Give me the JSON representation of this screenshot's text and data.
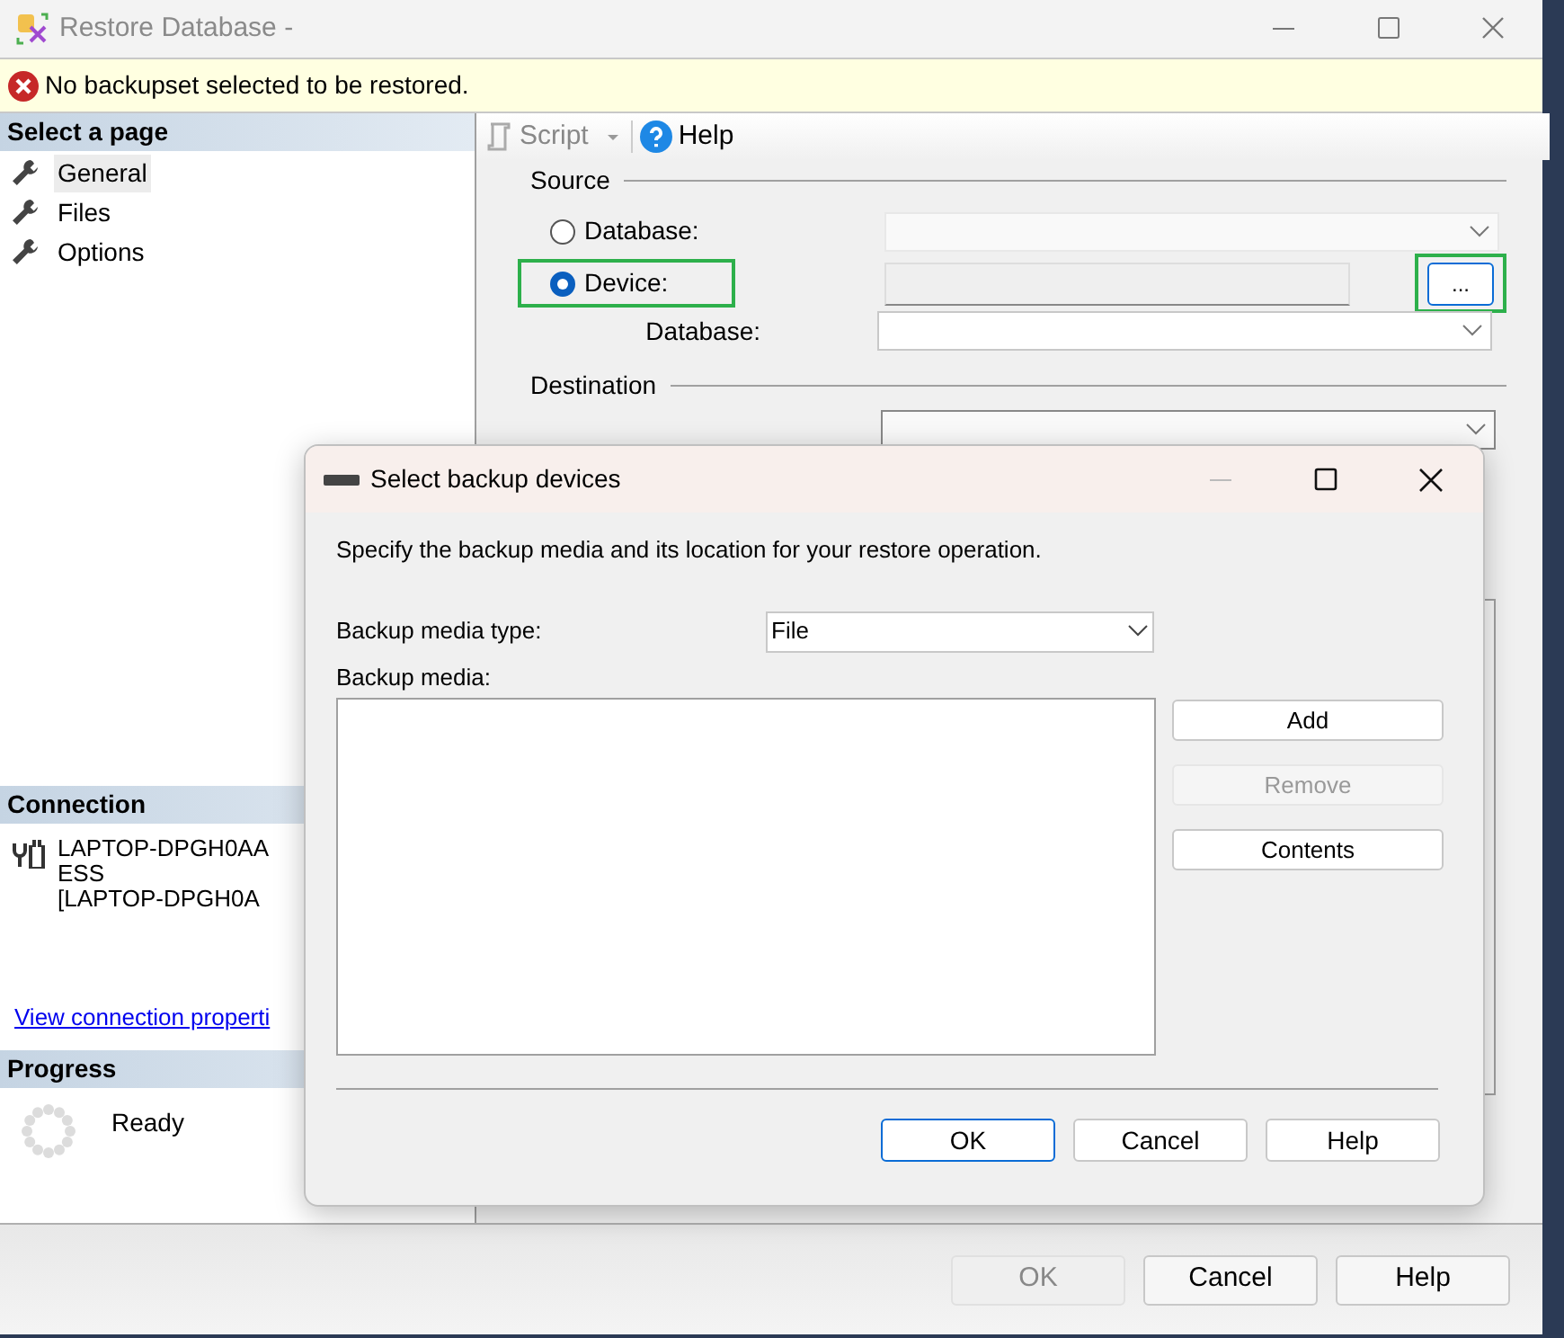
{
  "window": {
    "title": "Restore Database -"
  },
  "message": {
    "text": "No backupset selected to be restored."
  },
  "sidebar": {
    "header": "Select a page",
    "pages": [
      {
        "label": "General",
        "selected": true
      },
      {
        "label": "Files",
        "selected": false
      },
      {
        "label": "Options",
        "selected": false
      }
    ]
  },
  "connection": {
    "header": "Connection",
    "lines": [
      "LAPTOP-DPGH0AA",
      "ESS",
      "[LAPTOP-DPGH0A"
    ],
    "link": "View connection properti"
  },
  "progress": {
    "header": "Progress",
    "status": "Ready"
  },
  "toolbar": {
    "script": "Script",
    "help": "Help"
  },
  "source": {
    "title": "Source",
    "options": [
      {
        "label": "Database:",
        "selected": false,
        "highlighted": false
      },
      {
        "label": "Device:",
        "selected": true,
        "highlighted": true
      }
    ],
    "database_label": "Database:",
    "browse_button": "...",
    "browse_highlighted": true
  },
  "destination": {
    "title": "Destination"
  },
  "footer_buttons": [
    {
      "label": "OK",
      "disabled": true
    },
    {
      "label": "Cancel",
      "disabled": false
    },
    {
      "label": "Help",
      "disabled": false
    }
  ],
  "dialog": {
    "title": "Select backup devices",
    "instruction": "Specify the backup media and its location for your restore operation.",
    "media_type_label": "Backup media type:",
    "media_type": "File",
    "media_label": "Backup media:",
    "side_buttons": [
      {
        "label": "Add",
        "disabled": false
      },
      {
        "label": "Remove",
        "disabled": true
      },
      {
        "label": "Contents",
        "disabled": false
      }
    ],
    "buttons": [
      {
        "label": "OK",
        "default": true
      },
      {
        "label": "Cancel",
        "default": false
      },
      {
        "label": "Help",
        "default": false
      }
    ]
  }
}
